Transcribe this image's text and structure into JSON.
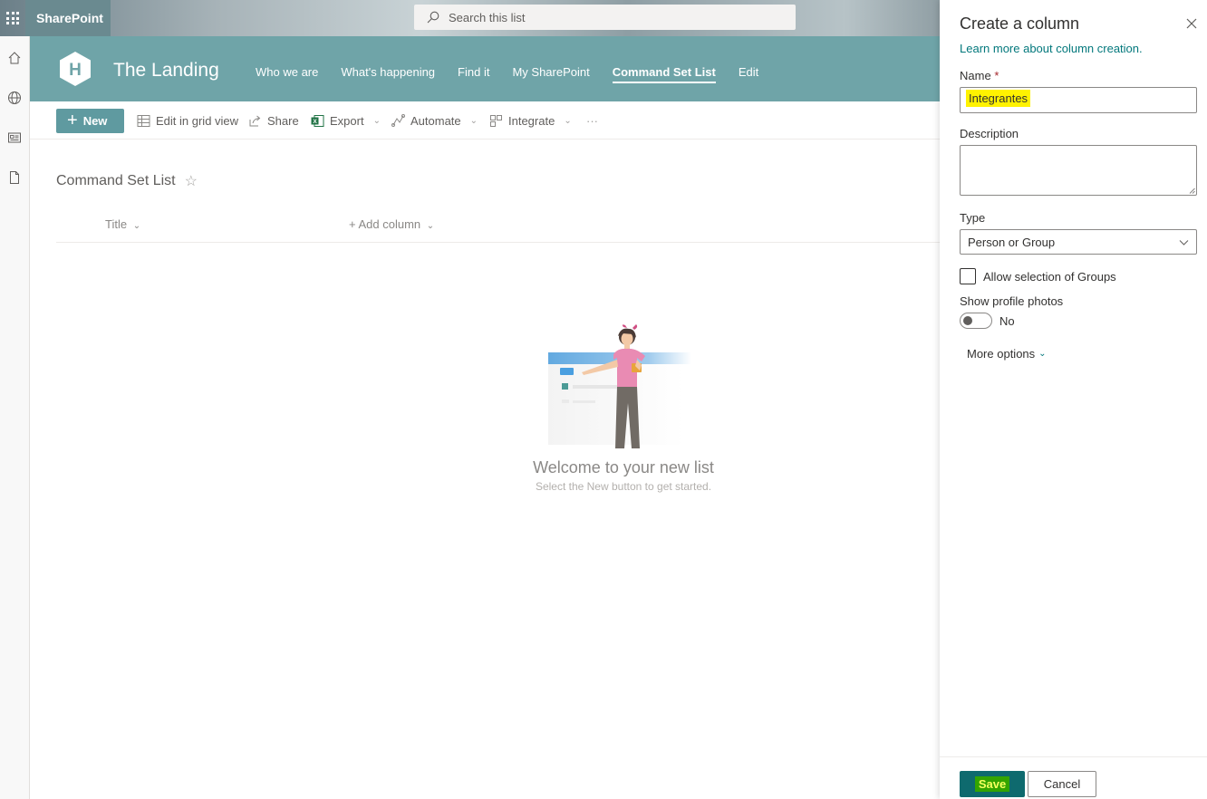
{
  "suite": {
    "app_name": "SharePoint",
    "search_placeholder": "Search this list"
  },
  "site": {
    "logo_letter": "H",
    "title": "The Landing",
    "nav": [
      {
        "label": "Who we are"
      },
      {
        "label": "What's happening"
      },
      {
        "label": "Find it"
      },
      {
        "label": "My SharePoint"
      },
      {
        "label": "Command Set List",
        "active": true
      },
      {
        "label": "Edit"
      }
    ]
  },
  "commandbar": {
    "new_label": "New",
    "grid_label": "Edit in grid view",
    "share_label": "Share",
    "export_label": "Export",
    "automate_label": "Automate",
    "integrate_label": "Integrate",
    "more_label": "···"
  },
  "list": {
    "title": "Command Set List",
    "columns": {
      "title": "Title",
      "add": "Add column"
    },
    "empty_title": "Welcome to your new list",
    "empty_subtitle": "Select the New button to get started."
  },
  "panel": {
    "title": "Create a column",
    "learn_more": "Learn more about column creation.",
    "name_label": "Name",
    "required_mark": "*",
    "name_value": "Integrantes",
    "description_label": "Description",
    "description_value": "",
    "type_label": "Type",
    "type_value": "Person or Group",
    "allow_groups_label": "Allow selection of Groups",
    "allow_groups_checked": false,
    "profile_photos_label": "Show profile photos",
    "profile_photos_state": "No",
    "more_options": "More options",
    "save": "Save",
    "cancel": "Cancel"
  },
  "colors": {
    "header": "#6fa4a8",
    "accent": "#0e6a6e",
    "link": "#03787c",
    "highlight": "#fff200"
  }
}
